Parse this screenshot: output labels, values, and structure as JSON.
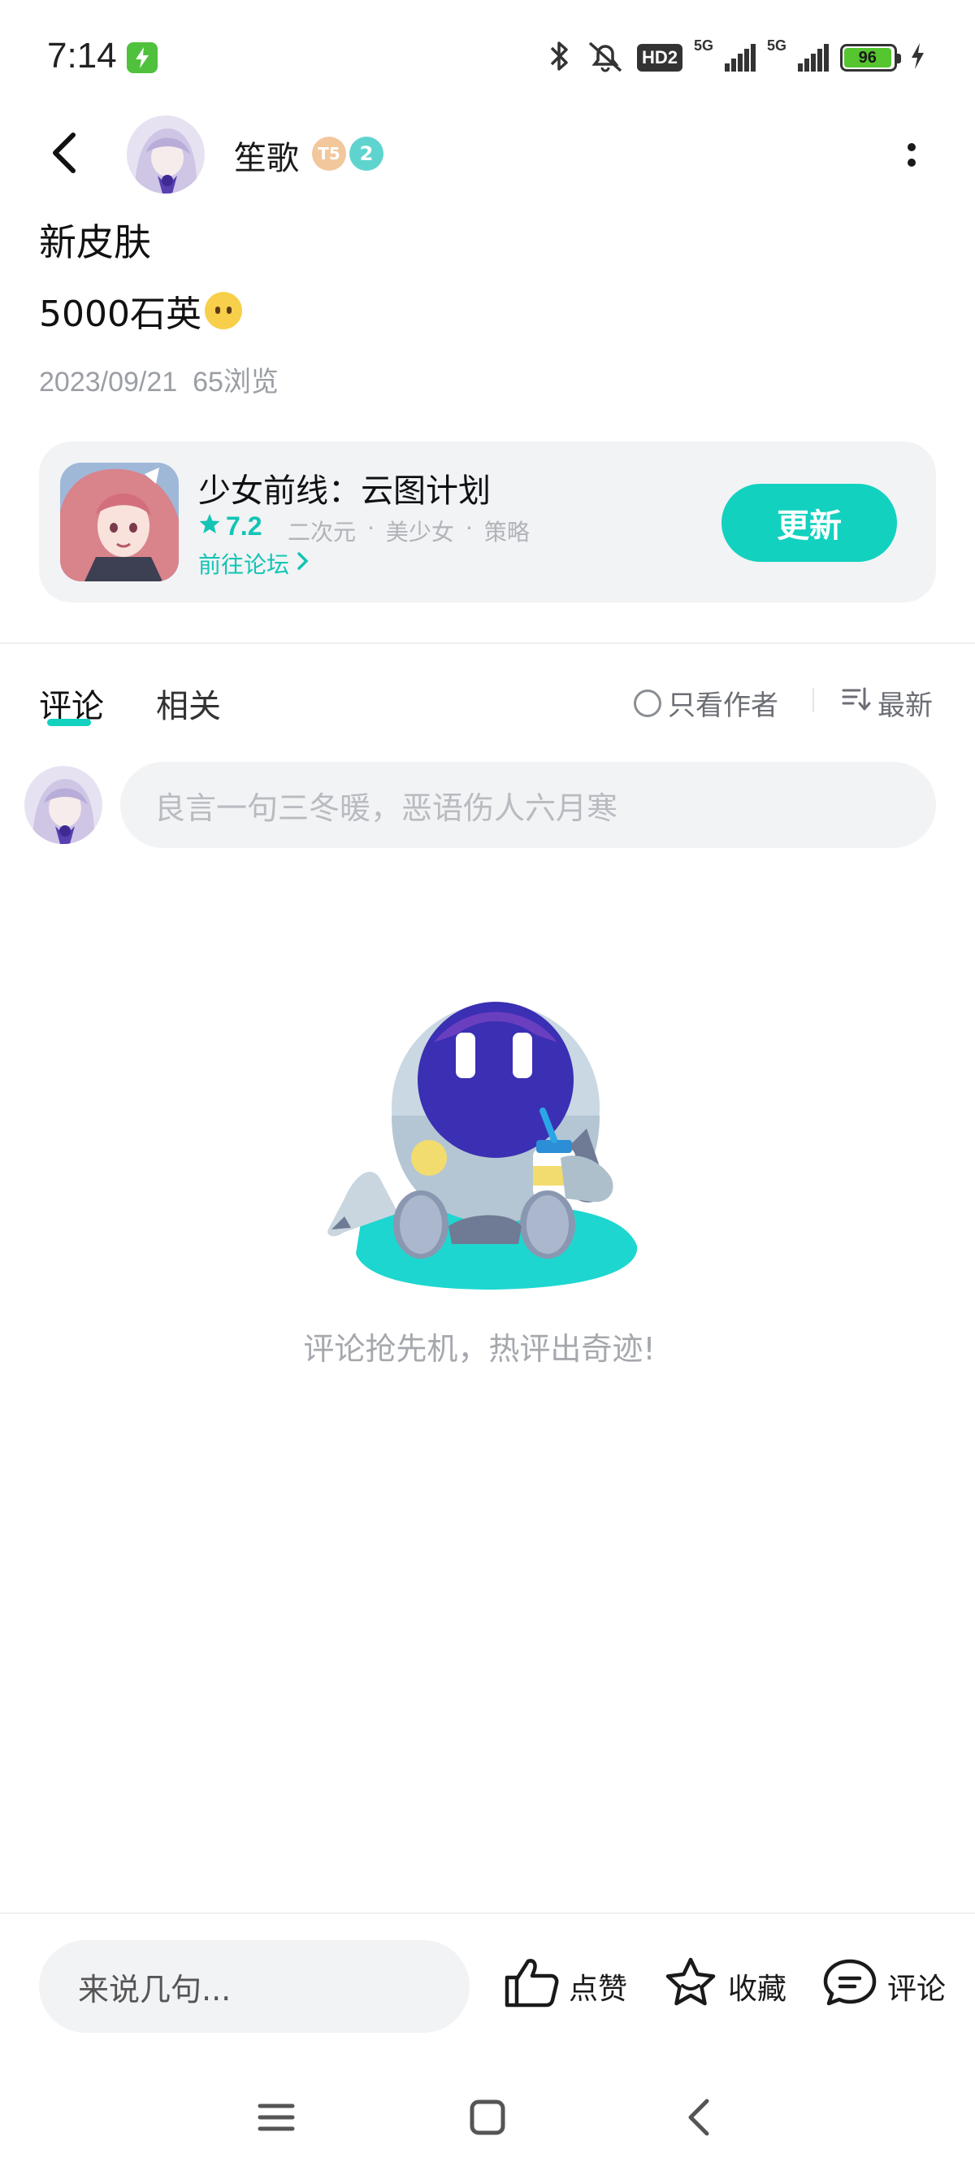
{
  "status_bar": {
    "time": "7:14",
    "hd_label": "HD2",
    "network_1": "5G",
    "network_2": "5G",
    "battery": "96"
  },
  "header": {
    "author_name": "笙歌",
    "level_badge_1": "T5",
    "level_badge_2": "2"
  },
  "post": {
    "title": "新皮肤",
    "body": "5000石英",
    "date": "2023/09/21",
    "views": "65浏览"
  },
  "game_card": {
    "name": "少女前线：云图计划",
    "rating": "7.2",
    "tags": [
      "二次元",
      "·",
      "美少女",
      "·",
      "策略"
    ],
    "forum_link": "前往论坛",
    "update_button": "更新"
  },
  "tabs": {
    "comments": "评论",
    "related": "相关",
    "author_only": "只看作者",
    "sort": "最新"
  },
  "comment_box": {
    "placeholder": "良言一句三冬暖，恶语伤人六月寒"
  },
  "empty_state": {
    "text": "评论抢先机，热评出奇迹!"
  },
  "bottom_bar": {
    "input_placeholder": "来说几句...",
    "like_label": "点赞",
    "favorite_label": "收藏",
    "comment_label": "评论"
  },
  "colors": {
    "accent": "#13d1bf",
    "accent_text": "#13c4b4"
  }
}
